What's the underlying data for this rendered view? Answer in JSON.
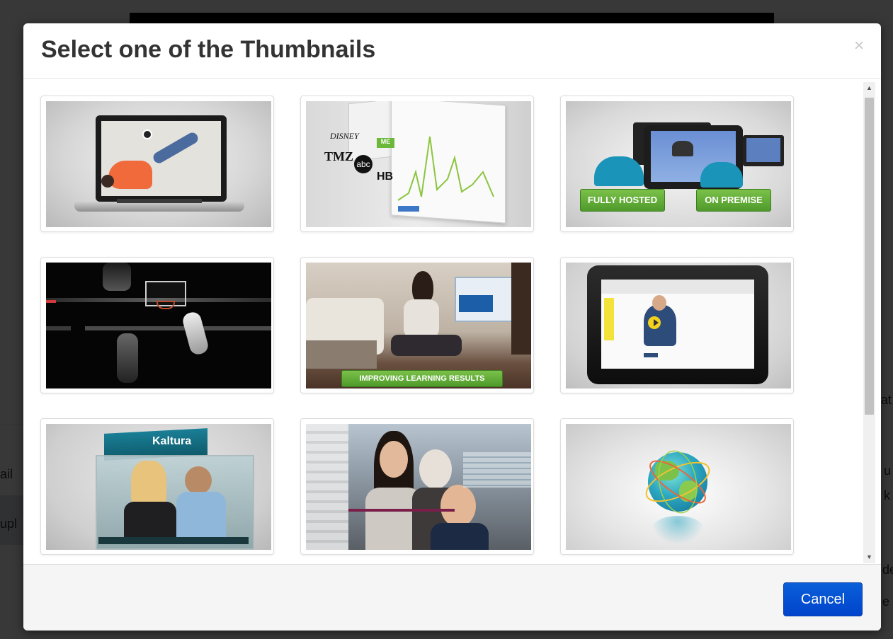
{
  "modal": {
    "title": "Select one of the Thumbnails",
    "close_glyph": "×",
    "cancel_label": "Cancel"
  },
  "thumbnails": [
    {
      "id": 1,
      "subject": "laptop-floor"
    },
    {
      "id": 2,
      "subject": "analytics-brands",
      "brand_labels": [
        "DISNEY",
        "TMZ",
        "abc",
        "HB"
      ]
    },
    {
      "id": 3,
      "subject": "hosting-options",
      "labels": [
        "FULLY HOSTED",
        "ON PREMISE"
      ]
    },
    {
      "id": 4,
      "subject": "basketball"
    },
    {
      "id": 5,
      "subject": "learning",
      "labels": [
        "IMPROVING LEARNING RESULTS"
      ]
    },
    {
      "id": 6,
      "subject": "tablet-lecture"
    },
    {
      "id": 7,
      "subject": "kaltura-box",
      "labels": [
        "Kaltura"
      ]
    },
    {
      "id": 8,
      "subject": "video-call"
    },
    {
      "id": 9,
      "subject": "globe"
    }
  ],
  "background_fragments": [
    "ail",
    "upl",
    "at",
    "k",
    "u",
    "de",
    "e"
  ],
  "colors": {
    "accent_button": "#0044cc",
    "green_badge": "#5aad32"
  }
}
